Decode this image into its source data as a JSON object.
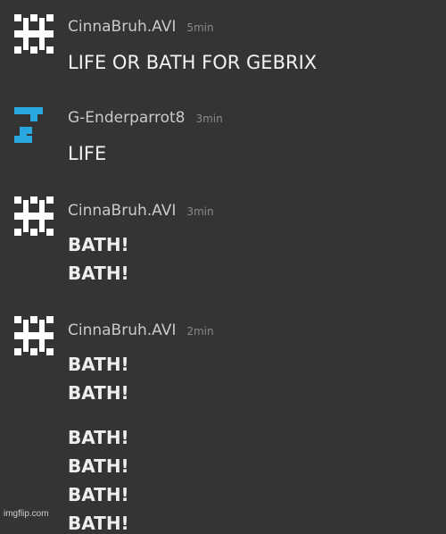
{
  "messages": [
    {
      "user": "CinnaBruh.AVI",
      "time": "5min",
      "avatar_icon": "hash-pixel-avatar-icon",
      "avatar_color": "#ffffff",
      "lines": [
        "LIFE OR BATH FOR GEBRIX"
      ]
    },
    {
      "user": "G-Enderparrot8",
      "time": "3min",
      "avatar_icon": "blue-pixel-avatar-icon",
      "avatar_color": "#2aa7df",
      "lines": [
        "LIFE"
      ]
    },
    {
      "user": "CinnaBruh.AVI",
      "time": "3min",
      "avatar_icon": "hash-pixel-avatar-icon",
      "avatar_color": "#ffffff",
      "lines": [
        "BATH!",
        "BATH!"
      ]
    },
    {
      "user": "CinnaBruh.AVI",
      "time": "2min",
      "avatar_icon": "hash-pixel-avatar-icon",
      "avatar_color": "#ffffff",
      "lines": [
        "BATH!",
        "BATH!",
        "BATH!",
        "BATH!",
        "BATH!",
        "BATH!"
      ]
    }
  ],
  "watermark": "imgflip.com"
}
